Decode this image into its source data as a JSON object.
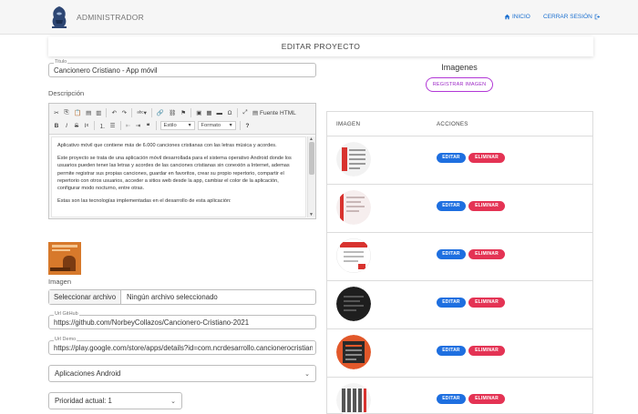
{
  "navbar": {
    "brand": "ADMINISTRADOR",
    "home_label": "INICIO",
    "logout_label": "CERRAR SESIÓN",
    "home_icon": "home-icon",
    "logout_icon": "logout-icon",
    "link_color": "#1a6fd0"
  },
  "page": {
    "section_title": "EDITAR PROYECTO"
  },
  "form": {
    "title_label": "Titulo",
    "title_value": "Cancionero Cristiano - App móvil",
    "description_label": "Descripción",
    "toolbar": {
      "source_label": "Fuente HTML",
      "style_select": "Estilo",
      "format_select": "Formato"
    },
    "description_paragraphs": [
      "Aplicativo móvil que contiene más de 6.000 canciones cristianas con las letras música y acordes.",
      "Este proyecto se trata de una aplicación móvil desarrollada para el sistema operativo Android donde los usuarios pueden tener las letras y acordes de las canciones cristianas sin conexión a Internet, ademas permite registrar sus propias canciones, guardar en favoritos, crear su propio repertorio, compartir el repertorio con otros usuarios, acceder a sitios web desde la app, cambiar el color de la aplicación, configurar modo nocturno, entre otras.",
      "Estas son las tecnologías implementadas en el desarrollo de esta aplicación:"
    ],
    "image_label": "Imagen",
    "file_button": "Seleccionar archivo",
    "file_status": "Ningún archivo seleccionado",
    "github_label": "Url GitHub",
    "github_value": "https://github.com/NorbeyCollazos/Cancionero-Cristiano-2021",
    "demo_label": "Url Demo",
    "demo_value": "https://play.google.com/store/apps/details?id=com.ncrdesarrollo.cancionerocristiano",
    "category_value": "Aplicaciones Android",
    "priority_value": "Prioridad actual: 1"
  },
  "images": {
    "title": "Imagenes",
    "register_button": "REGISTRAR IMAGEN",
    "col_image": "IMAGEN",
    "col_actions": "ACCIONES",
    "edit_label": "EDITAR",
    "delete_label": "ELIMINAR",
    "edit_color": "#1e6fe0",
    "delete_color": "#e43354",
    "rows": [
      {
        "theme": "light-list"
      },
      {
        "theme": "light-red"
      },
      {
        "theme": "white-red"
      },
      {
        "theme": "dark"
      },
      {
        "theme": "orange"
      },
      {
        "theme": "piano"
      }
    ]
  }
}
